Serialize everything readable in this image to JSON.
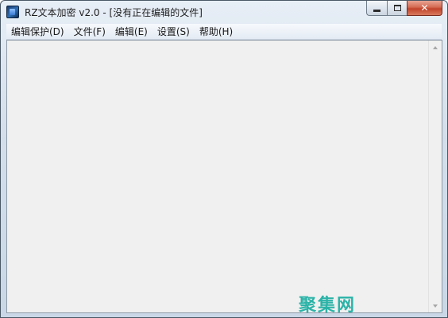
{
  "window": {
    "title": "RZ文本加密 v2.0 - [没有正在编辑的文件]",
    "icon": "app-lock-icon"
  },
  "menu": {
    "items": [
      {
        "label": "编辑保护(D)"
      },
      {
        "label": "文件(F)"
      },
      {
        "label": "编辑(E)"
      },
      {
        "label": "设置(S)"
      },
      {
        "label": "帮助(H)"
      }
    ]
  },
  "editor": {
    "content": ""
  },
  "watermark": {
    "text": "聚集网"
  },
  "colors": {
    "editor_background": "#f0f0f0",
    "watermark": "#2bb3a8",
    "close_button": "#c1432a"
  }
}
